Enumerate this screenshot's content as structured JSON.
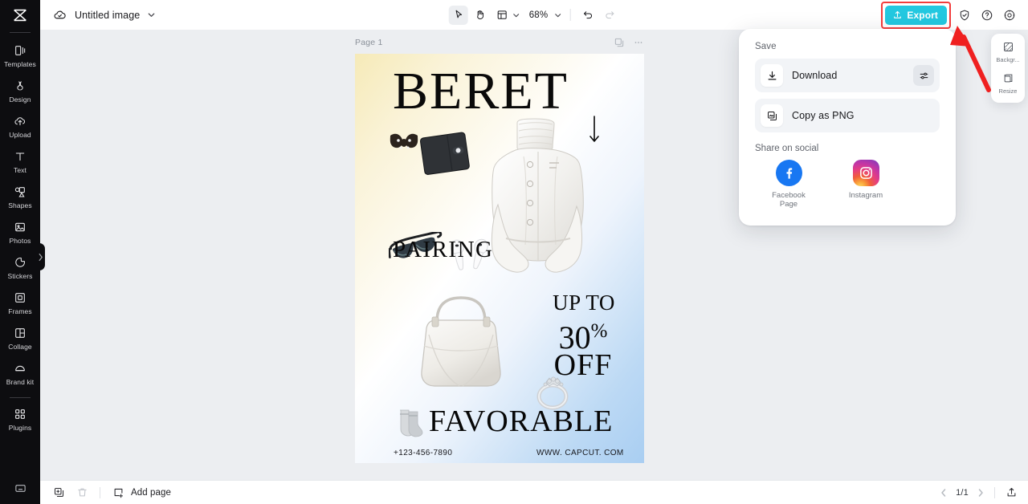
{
  "app": {
    "name": "CapCut Editor",
    "accent_color": "#23c8e0",
    "highlight_color": "#f23c3c"
  },
  "topbar": {
    "cloud_icon": "cloud-check-icon",
    "document_title": "Untitled image",
    "title_chevron_icon": "chevron-down-icon",
    "tools": [
      {
        "name": "select-tool",
        "icon": "cursor-arrow-icon",
        "selected": true
      },
      {
        "name": "hand-tool",
        "icon": "hand-icon",
        "selected": false
      },
      {
        "name": "layout-tool",
        "icon": "layout-panel-icon",
        "selected": false
      }
    ],
    "layout_chevron_icon": "chevron-down-icon",
    "zoom_level": "68%",
    "zoom_chevron_icon": "chevron-down-icon",
    "undo_icon": "undo-arrow-icon",
    "redo_icon": "redo-arrow-icon",
    "export_label": "Export",
    "export_icon": "upload-icon",
    "right_icons": [
      {
        "name": "shield-check-icon",
        "label": "Security"
      },
      {
        "name": "help-question-icon",
        "label": "Help"
      },
      {
        "name": "settings-gear-icon",
        "label": "Settings"
      }
    ]
  },
  "sidebar": {
    "logo_icon": "capcut-logo-icon",
    "items": [
      {
        "label": "Templates",
        "icon": "templates-icon"
      },
      {
        "label": "Design",
        "icon": "design-icon"
      },
      {
        "label": "Upload",
        "icon": "upload-cloud-icon"
      },
      {
        "label": "Text",
        "icon": "text-t-icon"
      },
      {
        "label": "Shapes",
        "icon": "shapes-icon"
      },
      {
        "label": "Photos",
        "icon": "photos-image-icon"
      },
      {
        "label": "Stickers",
        "icon": "stickers-icon"
      },
      {
        "label": "Frames",
        "icon": "frames-icon"
      },
      {
        "label": "Collage",
        "icon": "collage-icon"
      },
      {
        "label": "Brand kit",
        "icon": "brand-kit-icon"
      },
      {
        "label": "Plugins",
        "icon": "plugins-grid-icon"
      }
    ],
    "bottom_icon": "keyboard-shortcuts-icon",
    "collapse_handle_icon": "chevron-right-icon"
  },
  "canvas": {
    "page_label": "Page 1",
    "header_icons": [
      {
        "name": "duplicate-page-icon"
      },
      {
        "name": "page-more-options-icon"
      }
    ],
    "poster": {
      "headline": "BERET",
      "arrow_icon": "down-arrow-icon",
      "subhead": "PAIRING",
      "offer_line1": "UP TO",
      "offer_amount": "30",
      "offer_percent": "%",
      "offer_line3": "OFF",
      "footer_word": "FAVORABLE",
      "phone": "+123-456-7890",
      "website": "WWW. CAPCUT. COM",
      "gradient_from": "#f6eab8",
      "gradient_to": "#a9cef2"
    }
  },
  "export_panel": {
    "save_title": "Save",
    "save_options": [
      {
        "label": "Download",
        "icon": "download-icon",
        "has_settings": true,
        "settings_icon": "sliders-icon"
      },
      {
        "label": "Copy as PNG",
        "icon": "copy-image-icon",
        "has_settings": false
      }
    ],
    "social_title": "Share on social",
    "social_options": [
      {
        "label": "Facebook Page",
        "icon": "facebook-icon",
        "color": "#1877f2"
      },
      {
        "label": "Instagram",
        "icon": "instagram-icon",
        "color": "#c536a4"
      }
    ]
  },
  "right_panel": {
    "items": [
      {
        "label": "Backgr...",
        "icon": "background-icon"
      },
      {
        "label": "Resize",
        "icon": "resize-icon"
      }
    ]
  },
  "bottombar": {
    "duplicate_icon": "duplicate-icon",
    "delete_icon": "trash-icon",
    "add_page_label": "Add page",
    "add_page_icon": "add-page-icon",
    "prev_icon": "chevron-left-icon",
    "next_icon": "chevron-right-icon",
    "page_indicator": "1/1",
    "export_bottom_icon": "export-share-icon"
  }
}
